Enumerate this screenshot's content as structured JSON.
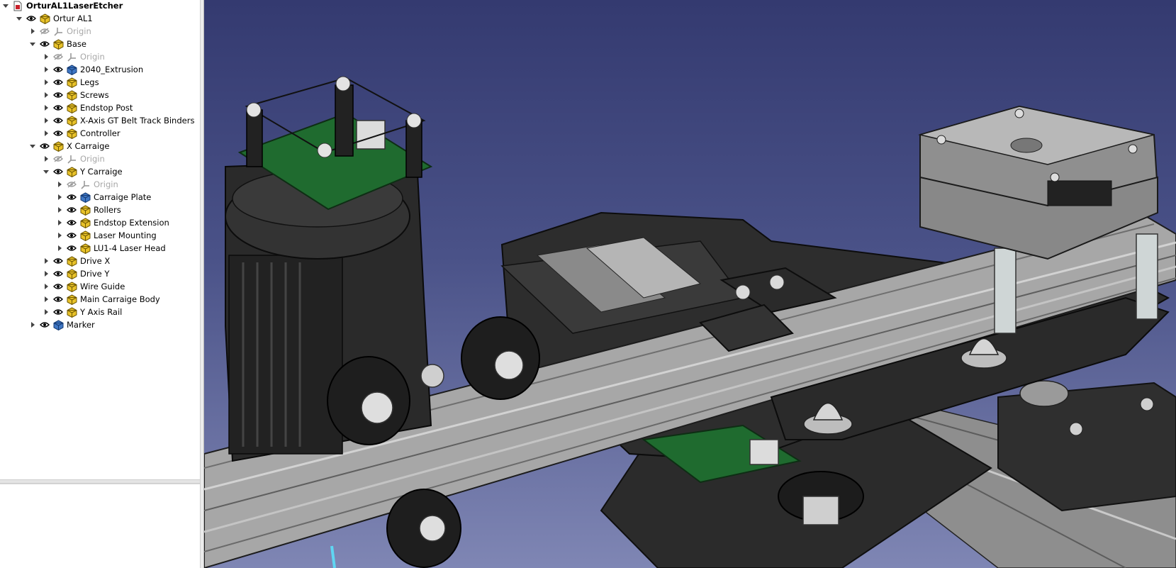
{
  "tree": {
    "items": [
      {
        "label": "OrturAL1LaserEtcher",
        "depth": 0,
        "expander": "down",
        "icon": "document-icon",
        "bold": true
      },
      {
        "label": "Ortur AL1",
        "depth": 1,
        "expander": "down",
        "eye": "visible",
        "icon": "part-icon"
      },
      {
        "label": "Origin",
        "depth": 2,
        "expander": "right",
        "eye": "hidden",
        "icon": "origin-icon",
        "disabled": true
      },
      {
        "label": "Base",
        "depth": 2,
        "expander": "down",
        "eye": "visible",
        "icon": "part-icon"
      },
      {
        "label": "Origin",
        "depth": 3,
        "expander": "right",
        "eye": "hidden",
        "icon": "origin-icon",
        "disabled": true
      },
      {
        "label": "2040_Extrusion",
        "depth": 3,
        "expander": "right",
        "eye": "visible",
        "icon": "body-icon"
      },
      {
        "label": "Legs",
        "depth": 3,
        "expander": "right",
        "eye": "visible",
        "icon": "part-icon"
      },
      {
        "label": "Screws",
        "depth": 3,
        "expander": "right",
        "eye": "visible",
        "icon": "part-icon"
      },
      {
        "label": "Endstop Post",
        "depth": 3,
        "expander": "right",
        "eye": "visible",
        "icon": "part-icon"
      },
      {
        "label": "X-Axis GT Belt Track Binders",
        "depth": 3,
        "expander": "right",
        "eye": "visible",
        "icon": "part-icon"
      },
      {
        "label": "Controller",
        "depth": 3,
        "expander": "right",
        "eye": "visible",
        "icon": "part-icon"
      },
      {
        "label": "X Carraige",
        "depth": 2,
        "expander": "down",
        "eye": "visible",
        "icon": "part-icon"
      },
      {
        "label": "Origin",
        "depth": 3,
        "expander": "right",
        "eye": "hidden",
        "icon": "origin-icon",
        "disabled": true
      },
      {
        "label": "Y Carraige",
        "depth": 3,
        "expander": "down",
        "eye": "visible",
        "icon": "part-icon"
      },
      {
        "label": "Origin",
        "depth": 4,
        "expander": "right",
        "eye": "hidden",
        "icon": "origin-icon",
        "disabled": true
      },
      {
        "label": "Carraige Plate",
        "depth": 4,
        "expander": "right",
        "eye": "visible",
        "icon": "body-icon"
      },
      {
        "label": "Rollers",
        "depth": 4,
        "expander": "right",
        "eye": "visible",
        "icon": "part-icon"
      },
      {
        "label": "Endstop Extension",
        "depth": 4,
        "expander": "right",
        "eye": "visible",
        "icon": "part-icon"
      },
      {
        "label": "Laser Mounting",
        "depth": 4,
        "expander": "right",
        "eye": "visible",
        "icon": "part-icon"
      },
      {
        "label": "LU1-4 Laser Head",
        "depth": 4,
        "expander": "right",
        "eye": "visible",
        "icon": "part-icon"
      },
      {
        "label": "Drive X",
        "depth": 3,
        "expander": "right",
        "eye": "visible",
        "icon": "part-icon"
      },
      {
        "label": "Drive Y",
        "depth": 3,
        "expander": "right",
        "eye": "visible",
        "icon": "part-icon"
      },
      {
        "label": "Wire Guide",
        "depth": 3,
        "expander": "right",
        "eye": "visible",
        "icon": "part-icon"
      },
      {
        "label": "Main Carraige Body",
        "depth": 3,
        "expander": "right",
        "eye": "visible",
        "icon": "part-icon"
      },
      {
        "label": "Y Axis Rail",
        "depth": 3,
        "expander": "right",
        "eye": "visible",
        "icon": "part-icon"
      },
      {
        "label": "Marker",
        "depth": 2,
        "expander": "right",
        "eye": "visible",
        "icon": "body-icon"
      }
    ]
  },
  "colors": {
    "viewport_top": "#343a70",
    "viewport_bottom": "#7f86b4",
    "part_icon": "#e8c22a",
    "body_icon": "#3f77c4",
    "rail": "#a9a9a9",
    "plate": "#2e2e2e",
    "pcb": "#1f6b2f",
    "motor": "#8c8c8c"
  }
}
